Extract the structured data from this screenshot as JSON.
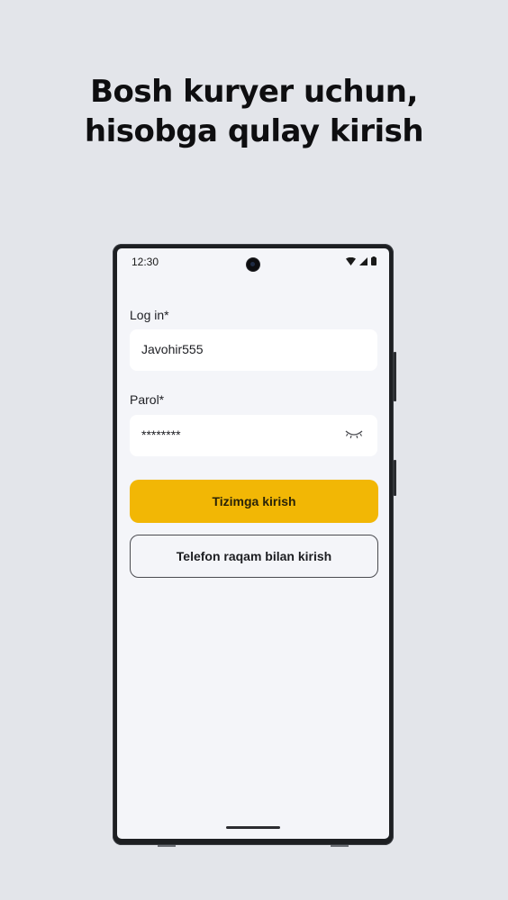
{
  "headline": {
    "line1": "Bosh kuryer uchun,",
    "line2": "hisobga qulay kirish"
  },
  "status_bar": {
    "time": "12:30",
    "icons": [
      "wifi-icon",
      "signal-icon",
      "battery-icon"
    ]
  },
  "login_form": {
    "login_label": "Log in*",
    "login_value": "Javohir555",
    "password_label": "Parol*",
    "password_value": "********",
    "password_toggle_icon": "eye-closed-icon",
    "submit_label": "Tizimga kirish",
    "phone_login_label": "Telefon raqam bilan kirish"
  },
  "colors": {
    "background": "#e3e5ea",
    "accent": "#f2b705",
    "screen": "#f4f5f9"
  }
}
